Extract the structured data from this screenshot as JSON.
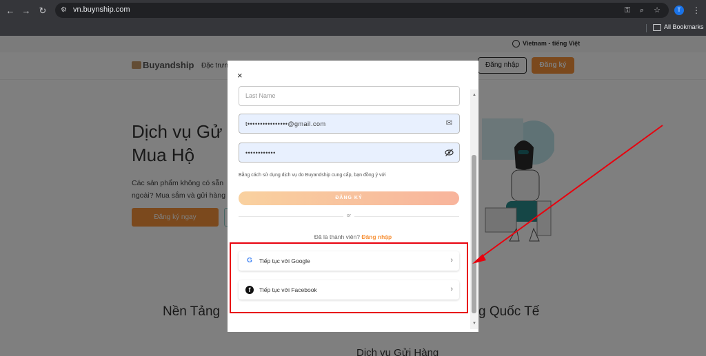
{
  "browser": {
    "url": "vn.buynship.com",
    "bookmarks_label": "All Bookmarks",
    "profile_initial": "T",
    "icons": [
      "back-icon",
      "forward-icon",
      "reload-icon",
      "site-info-icon",
      "password-key-icon",
      "zoom-icon",
      "star-icon",
      "menu-icon",
      "folder-icon"
    ]
  },
  "site": {
    "locale": "Vietnam - tiếng Việt",
    "logo": "Buyandship",
    "nav_item": "Đặc trưn",
    "login": "Đăng nhập",
    "signup": "Đăng ký",
    "hero_title_1": "Dịch vụ Gử",
    "hero_title_2": "Mua Hộ",
    "hero_desc_1": "Các sản phẩm không có sẵn",
    "hero_desc_2": "ngoài? Mua sắm và gửi hàng",
    "hero_button": "Đăng ký ngay",
    "section_left": "Nền Tảng",
    "section_right": "g Quốc Tế",
    "section_sub": "Dịch vụ Gửi Hàng"
  },
  "modal": {
    "last_name_placeholder": "Last Name",
    "email_value": "t••••••••••••••••@gmail.com",
    "password_value": "••••••••••••",
    "terms_text": "Bằng cách sử dụng dịch vụ do Buyandship cung cấp, bạn đồng ý với",
    "register_button": "ĐĂNG KÝ",
    "or_text": "or",
    "member_text": "Đã là thành viên?",
    "member_link": "Đăng nhập",
    "google_button": "Tiếp tục với Google",
    "facebook_button": "Tiếp tục với Facebook",
    "close": "×"
  },
  "colors": {
    "accent": "#f7933b",
    "highlight": "#e8000d"
  }
}
